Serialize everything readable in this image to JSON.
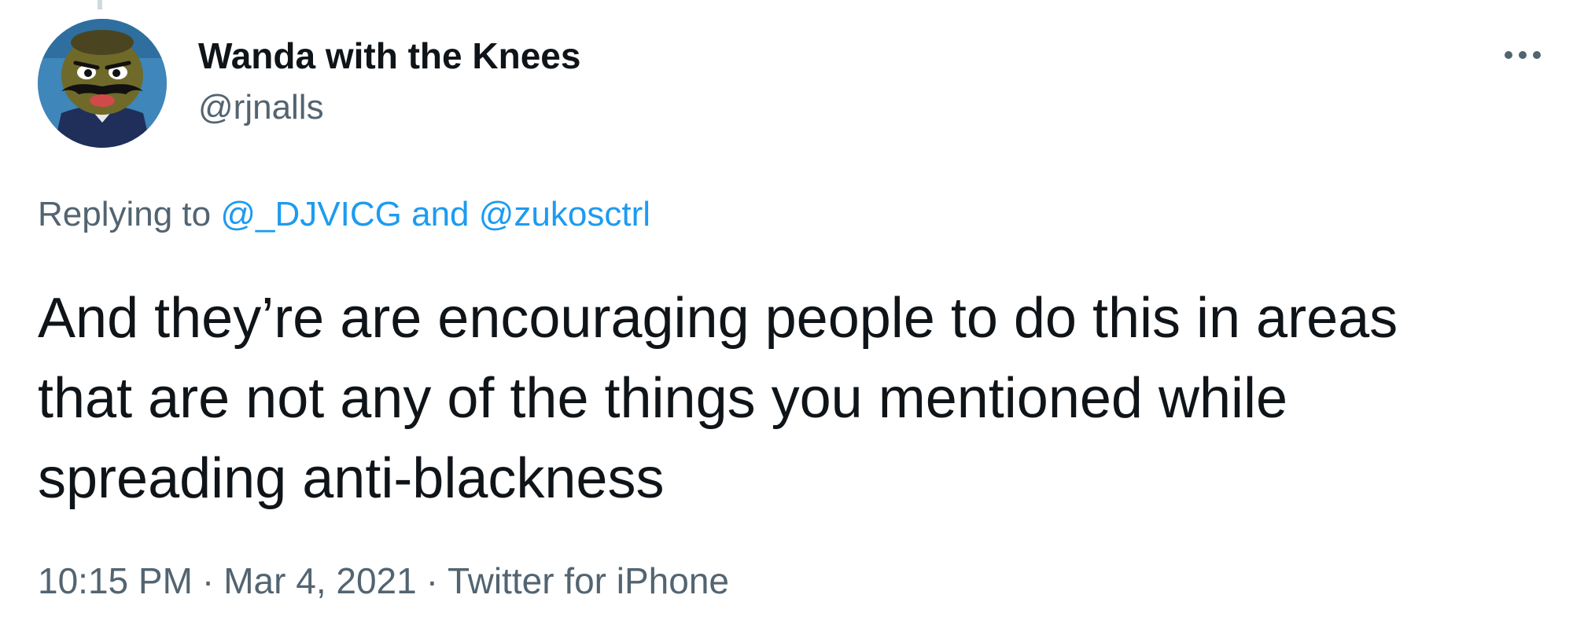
{
  "author": {
    "display_name": "Wanda with the Knees",
    "handle": "@rjnalls",
    "avatar_icon": "mustached-cartoon-avatar-icon"
  },
  "menu": {
    "more_icon": "more-horizontal-icon"
  },
  "reply_context": {
    "prefix": "Replying to",
    "mentions": [
      "@_DJVICG",
      "@zukosctrl"
    ],
    "conjunction": "and"
  },
  "tweet": {
    "lines": [
      "And they’re are encouraging people to do this in areas",
      "that are not any of the things you mentioned while",
      "spreading anti-blackness"
    ]
  },
  "meta": {
    "time": "10:15 PM",
    "separator": "·",
    "date": "Mar 4, 2021",
    "source": "Twitter for iPhone"
  },
  "colors": {
    "text_primary": "#0f1419",
    "text_secondary": "#536471",
    "link": "#1d9bf0",
    "background": "#ffffff"
  }
}
